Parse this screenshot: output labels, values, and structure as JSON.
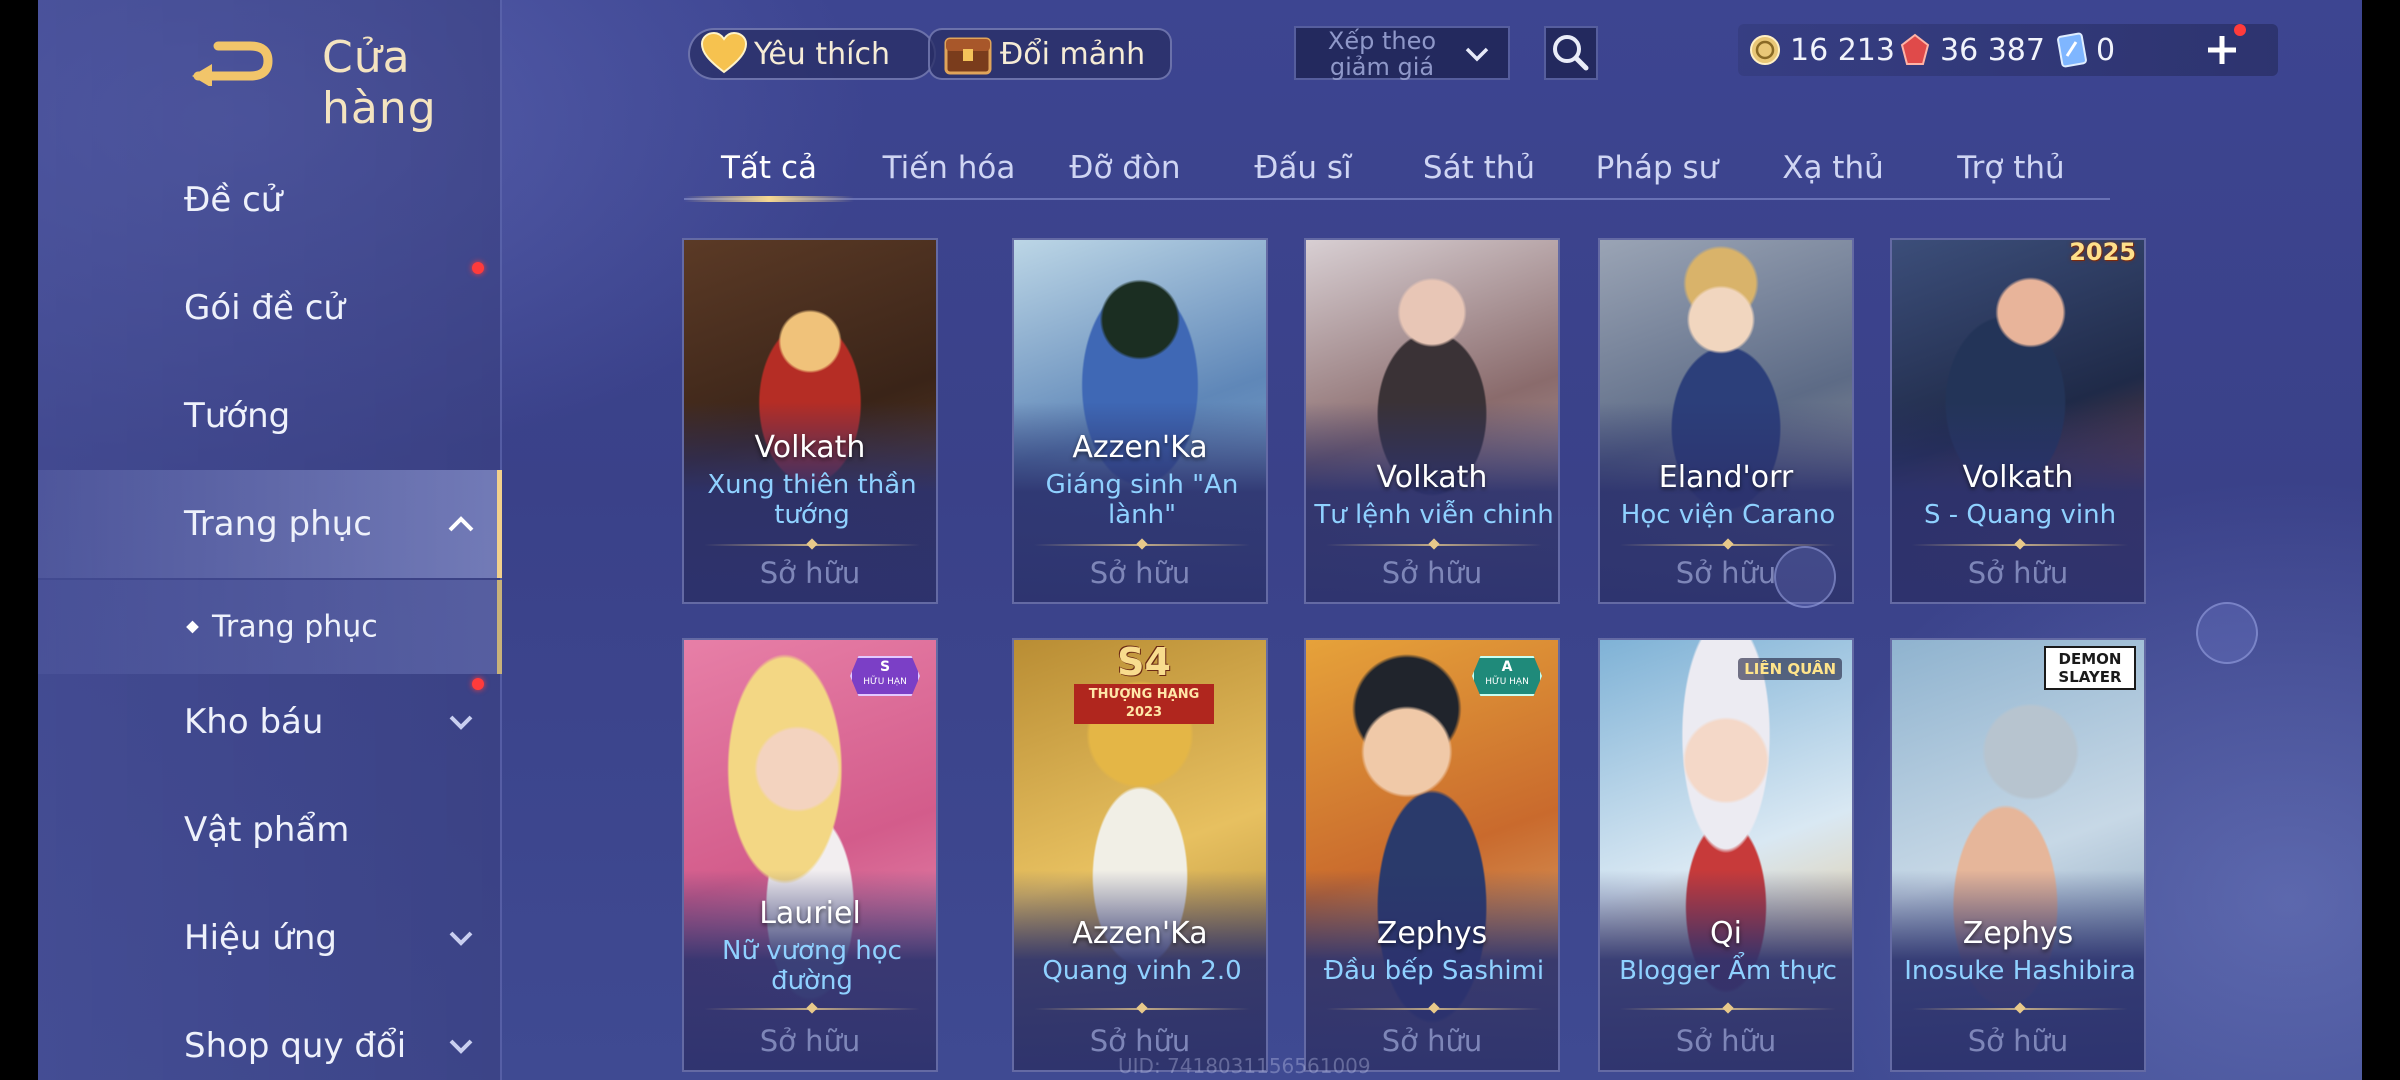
{
  "header": {
    "title": "Cửa hàng"
  },
  "sidebar": {
    "items": [
      {
        "label": "Đề cử"
      },
      {
        "label": "Gói đề cử"
      },
      {
        "label": "Tướng"
      },
      {
        "label": "Trang phục"
      },
      {
        "label": "Trang phục"
      },
      {
        "label": "Kho báu"
      },
      {
        "label": "Vật phẩm"
      },
      {
        "label": "Hiệu ứng"
      },
      {
        "label": "Shop quy đổi"
      }
    ]
  },
  "topbar": {
    "favorites_label": "Yêu thích",
    "exchange_label": "Đổi mảnh",
    "sort_label": "Xếp theo giảm giá",
    "currencies": [
      {
        "icon": "coin-icon",
        "value": "16 213"
      },
      {
        "icon": "ruby-icon",
        "value": "36 387"
      },
      {
        "icon": "voucher-icon",
        "value": "0"
      }
    ]
  },
  "tabs": [
    {
      "label": "Tất cả"
    },
    {
      "label": "Tiến hóa"
    },
    {
      "label": "Đỡ đòn"
    },
    {
      "label": "Đấu sĩ"
    },
    {
      "label": "Sát thủ"
    },
    {
      "label": "Pháp sư"
    },
    {
      "label": "Xạ thủ"
    },
    {
      "label": "Trợ thủ"
    }
  ],
  "cards": [
    {
      "hero": "Volkath",
      "skin": "Xung thiên thần tướng",
      "status": "Sở hữu"
    },
    {
      "hero": "Azzen'Ka",
      "skin": "Giáng sinh \"An lành\"",
      "status": "Sở hữu"
    },
    {
      "hero": "Volkath",
      "skin": "Tư lệnh viễn chinh",
      "status": "Sở hữu"
    },
    {
      "hero": "Eland'orr",
      "skin": "Học viện Carano",
      "status": "Sở hữu"
    },
    {
      "hero": "Volkath",
      "skin": "S - Quang vinh",
      "status": "Sở hữu",
      "badge": "2025"
    },
    {
      "hero": "Lauriel",
      "skin": "Nữ vương học đường",
      "status": "Sở hữu",
      "badge": "S",
      "badge_sub": "HỮU HẠN"
    },
    {
      "hero": "Azzen'Ka",
      "skin": "Quang vinh 2.0",
      "status": "Sở hữu",
      "badge": "S4",
      "badge_sub": "THƯỢNG HẠNG 2023"
    },
    {
      "hero": "Zephys",
      "skin": "Đầu bếp Sashimi",
      "status": "Sở hữu",
      "badge": "A",
      "badge_sub": "HỮU HẠN"
    },
    {
      "hero": "Qi",
      "skin": "Blogger Ẩm thực",
      "status": "Sở hữu",
      "badge": "LIÊN QUÂN"
    },
    {
      "hero": "Zephys",
      "skin": "Inosuke Hashibira",
      "status": "Sở hữu",
      "badge": "DEMON SLAYER"
    }
  ],
  "footer": {
    "uid": "UID: 7418031156561009"
  },
  "colors": {
    "accent_gold": "#f2d18c",
    "skin_name_blue": "#8fd1ff",
    "owned_gray": "#7e86b8",
    "notification_red": "#ff3b3b"
  }
}
